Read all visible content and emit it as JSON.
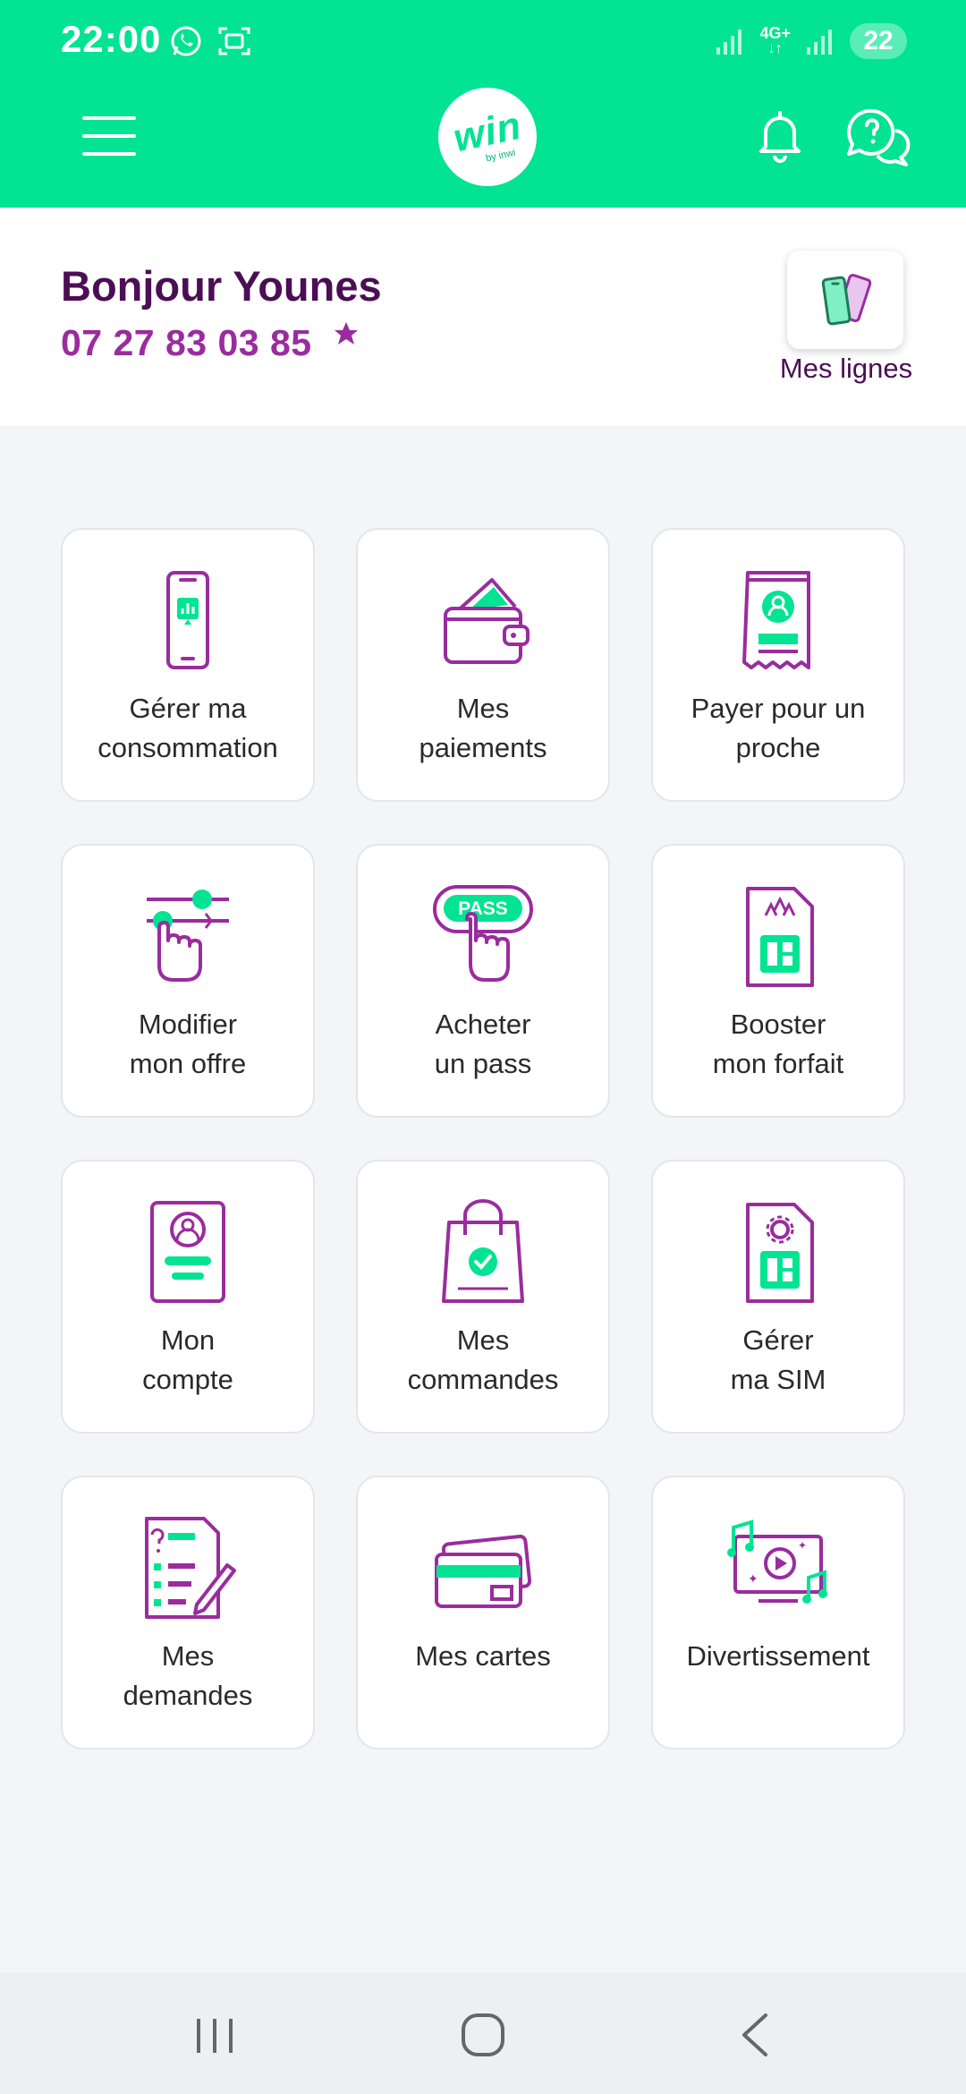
{
  "status_bar": {
    "time": "22:00",
    "network_label": "4G+",
    "battery": "22"
  },
  "header": {
    "logo_text": "win",
    "logo_subtext": "by inwi",
    "brand_color": "#02e393"
  },
  "greeting": {
    "hello": "Bonjour Younes",
    "phone": "07 27 83 03 85",
    "lines_button_label": "Mes lignes"
  },
  "tiles": [
    {
      "label": "Gérer ma\nconsommation",
      "icon": "phone-usage-icon"
    },
    {
      "label": "Mes\npaiements",
      "icon": "wallet-icon"
    },
    {
      "label": "Payer pour un\nproche",
      "icon": "receipt-person-icon"
    },
    {
      "label": "Modifier\nmon offre",
      "icon": "slider-hand-icon"
    },
    {
      "label": "Acheter\nun pass",
      "icon": "pass-hand-icon",
      "icon_text": "PASS"
    },
    {
      "label": "Booster\nmon forfait",
      "icon": "sim-boost-icon"
    },
    {
      "label": "Mon\ncompte",
      "icon": "account-card-icon"
    },
    {
      "label": "Mes\ncommandes",
      "icon": "shopping-bag-check-icon"
    },
    {
      "label": "Gérer\nma SIM",
      "icon": "sim-settings-icon"
    },
    {
      "label": "Mes\ndemandes",
      "icon": "requests-document-icon"
    },
    {
      "label": "Mes cartes",
      "icon": "cards-icon"
    },
    {
      "label": "Divertissement",
      "icon": "entertainment-icon"
    }
  ],
  "colors": {
    "primary_purple": "#9a2c9e",
    "dark_purple": "#4b0e55",
    "green": "#02e393"
  }
}
